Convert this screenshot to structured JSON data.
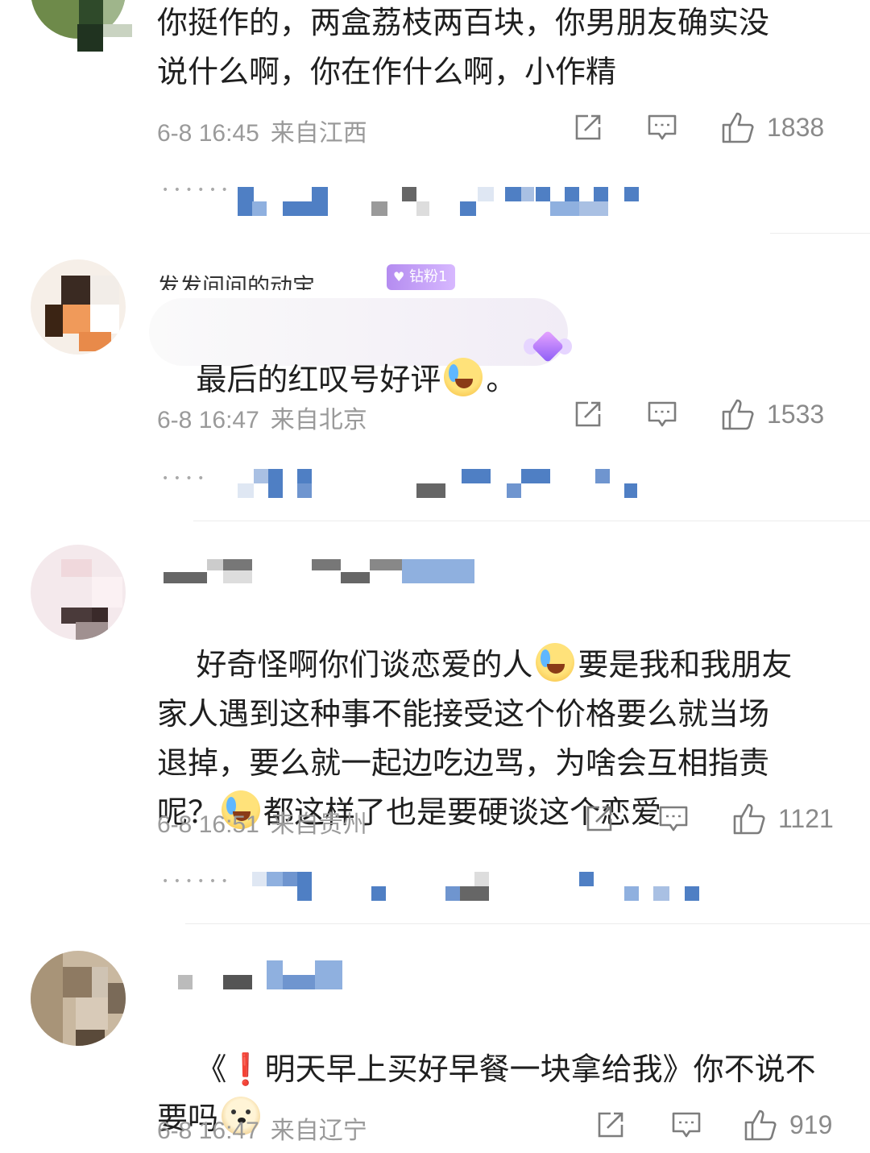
{
  "colors": {
    "body_text": "#1f1f1f",
    "meta_text": "#9a9a9a",
    "icon_stroke": "#7d7d7d",
    "mosaic_blue": "#4f7fc4",
    "badge_purple": "#b48cf0"
  },
  "comments": [
    {
      "text": "你挺作的，两盒荔枝两百块，你男朋友确实没\n说什么啊，你在作什么啊，小作精",
      "time": "6-8 16:45",
      "location": "来自江西",
      "likes": "1838",
      "icons": [
        "share-icon",
        "comment-icon",
        "thumbs-up-icon"
      ]
    },
    {
      "username_partial": "发发间间的动宝",
      "badge": "钻粉1",
      "text_before": "最后的红叹号好评",
      "emoji": "laugh-cry-emoji",
      "text_after": "。",
      "time": "6-8 16:47",
      "location": "来自北京",
      "likes": "1533",
      "icons": [
        "share-icon",
        "comment-icon",
        "thumbs-up-icon"
      ]
    },
    {
      "text_1": "好奇怪啊你们谈恋爱的人",
      "text_2": "要是我和我朋友",
      "text_3": "家人遇到这种事不能接受这个价格要么就当场\n退掉，要么就一起边吃边骂，为啥会互相指责\n呢？",
      "text_4": "都这样了也是要硬谈这个恋爱",
      "time": "6-8 16:51",
      "location": "来自贵州",
      "likes": "1121",
      "icons": [
        "share-icon",
        "comment-icon",
        "thumbs-up-icon"
      ]
    },
    {
      "text_1": "《",
      "exclaim": "❗",
      "text_2": "明天早上买好早餐一块拿给我》你不说不\n要吗",
      "emoji": "doge-emoji",
      "time": "6-8 16:47",
      "location": "来自辽宁",
      "likes": "919",
      "icons": [
        "share-icon",
        "comment-icon",
        "thumbs-up-icon"
      ]
    }
  ]
}
